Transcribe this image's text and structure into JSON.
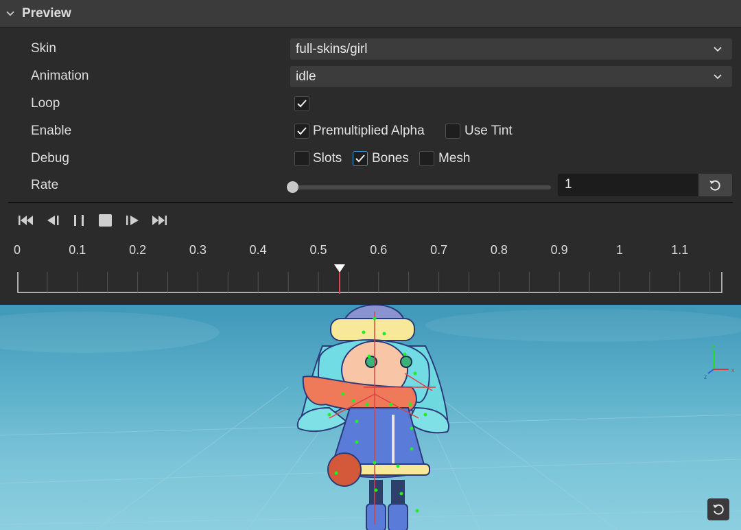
{
  "panel": {
    "title": "Preview",
    "collapse_icon": "chevron-down-icon"
  },
  "properties": {
    "skin": {
      "label": "Skin",
      "value": "full-skins/girl"
    },
    "animation": {
      "label": "Animation",
      "value": "idle"
    },
    "loop": {
      "label": "Loop",
      "checked": true
    },
    "enable": {
      "label": "Enable",
      "options": [
        {
          "label": "Premultiplied Alpha",
          "checked": true
        },
        {
          "label": "Use Tint",
          "checked": false
        }
      ]
    },
    "debug": {
      "label": "Debug",
      "options": [
        {
          "label": "Slots",
          "checked": false
        },
        {
          "label": "Bones",
          "checked": true
        },
        {
          "label": "Mesh",
          "checked": false
        }
      ]
    },
    "rate": {
      "label": "Rate",
      "value": "1",
      "slider_fraction": 0.0
    }
  },
  "playback": {
    "buttons": [
      "skip-to-start-icon",
      "step-back-icon",
      "pause-icon",
      "stop-icon",
      "step-forward-icon",
      "skip-to-end-icon"
    ]
  },
  "timeline": {
    "ticks": [
      "0",
      "0.1",
      "0.2",
      "0.3",
      "0.4",
      "0.5",
      "0.6",
      "0.7",
      "0.8",
      "0.9",
      "1",
      "1.1"
    ],
    "playhead_time": 0.54
  },
  "viewport": {
    "axis_labels": {
      "x": "x",
      "y": "y",
      "z": "z"
    }
  },
  "colors": {
    "accent": "#3a9ad8",
    "panel_bg": "#2b2b2b",
    "header_bg": "#3b3b3b",
    "playhead": "#dd4444"
  }
}
